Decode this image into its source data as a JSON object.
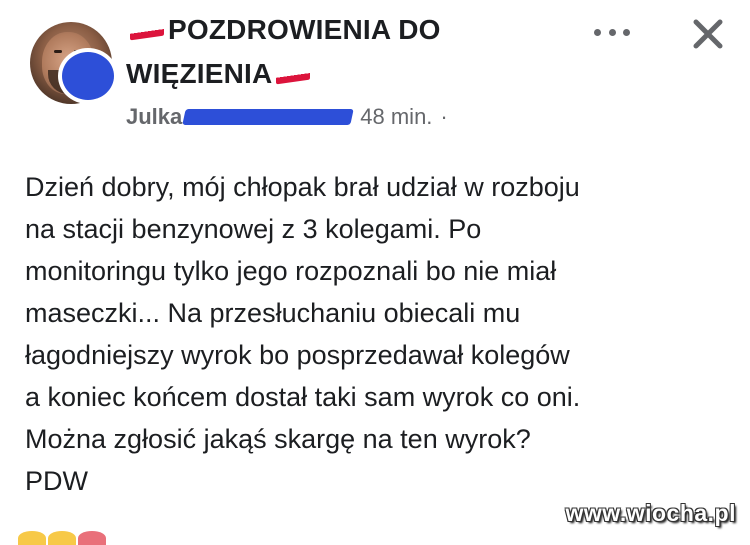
{
  "post": {
    "group_line1": "POZDROWIENIA DO",
    "group_line2": "WIĘZIENIA",
    "author": "Julka",
    "time": "48 min.",
    "separator": "·",
    "body_lines": [
      "Dzień dobry, mój chłopak brał udział w rozboju",
      "na stacji benzynowej z 3 kolegami. Po",
      "monitoringu tylko jego rozpoznali bo nie miał",
      "maseczki... Na przesłuchaniu obiecali mu",
      "łagodniejszy wyrok bo posprzedawał kolegów",
      "a koniec końcem dostał taki sam wyrok co oni.",
      "Można zgłosić jakąś skargę na ten wyrok?",
      "PDW"
    ]
  },
  "icons": {
    "more": "more-options-icon",
    "close": "close-icon",
    "flag": "poland-flag-icon",
    "avatar": "avatar"
  },
  "watermark": "www.wiocha.pl",
  "colors": {
    "text": "#1c1e21",
    "meta": "#65676b",
    "redaction": "#2d4fd8",
    "flag_red": "#dc143c"
  }
}
